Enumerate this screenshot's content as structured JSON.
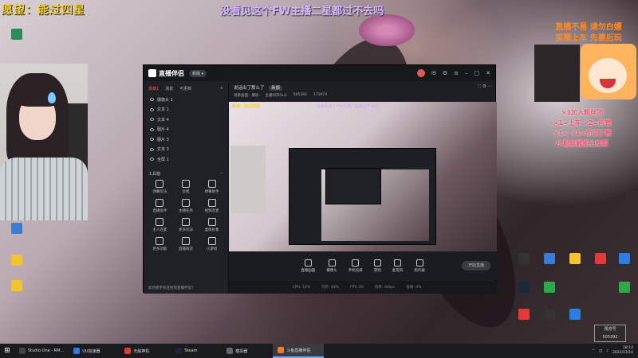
{
  "overlay": {
    "stream_title": "愿望：能过四星",
    "top_banner": "没看见这个FW主播二星都过不去吗",
    "right_notice_1": "直播不易 请勿白嫖",
    "right_notice_2": "买票上车 先要后玩",
    "gift_lines": [
      "×1加入粉丝团",
      "×1=上车   ×2=房管",
      "×1=    ×1=你说了算",
      "6.粉丝截图抽推票"
    ],
    "record_label": "预览号",
    "record_value": "505392"
  },
  "app": {
    "name": "直播伴侣",
    "badge": "新版 ▾",
    "tabs": [
      "场景1",
      "场景",
      "可更新"
    ],
    "active_tab": 0,
    "layers": [
      "摄像头 1",
      "文本 1",
      "文本 4",
      "图片 4",
      "图片 3",
      "文本 3",
      "全屏 1"
    ],
    "tools_title": "工具箱",
    "tools": [
      "弹幕玩法",
      "合唱",
      "弹幕助手",
      "直播助手",
      "主播任务",
      "视频连麦",
      "主人连麦",
      "更多玩法",
      "虚拟形象",
      "更多功能",
      "直播商店",
      "小游戏"
    ],
    "sidebar_footer": "如何把手机连接到直播伴侣？",
    "main_title": "说话出了那么了",
    "main_tag": "新版",
    "main_meta": [
      "场景画面：横屏",
      "主播间开Ou1",
      "505392",
      "171974"
    ],
    "preview_title": "愿望：能过四星",
    "preview_banner": "没看见这个FW主播二星都过不去吗",
    "bottom_actions": [
      "直播画面",
      "摄像头",
      "手机投屏",
      "游戏",
      "麦克风",
      "扬声器"
    ],
    "start_live": "开始直播",
    "status_bar": [
      "CPU: 14%",
      "内存: 48%",
      "FPS: 60",
      "码率: 0kbps",
      "丢帧: 0%"
    ]
  },
  "taskbar": {
    "start_icon": "windows-logo",
    "items": [
      {
        "label": "Studio One - RM...",
        "active": false
      },
      {
        "label": "UU加速器",
        "active": false
      },
      {
        "label": "无敌神机",
        "active": false
      },
      {
        "label": "Steam",
        "active": false
      },
      {
        "label": "模拟器",
        "active": false
      },
      {
        "label": "斗鱼直播伴侣",
        "active": true
      }
    ],
    "time": "18:14",
    "date": "2021/11/10"
  },
  "colors": {
    "title_yellow": "#f5d23a",
    "banner_purple": "#d8b6ff",
    "gift_red": "#ff4d6d",
    "notice_orange": "#ff8a2a",
    "app_bg": "#1e1f24"
  }
}
